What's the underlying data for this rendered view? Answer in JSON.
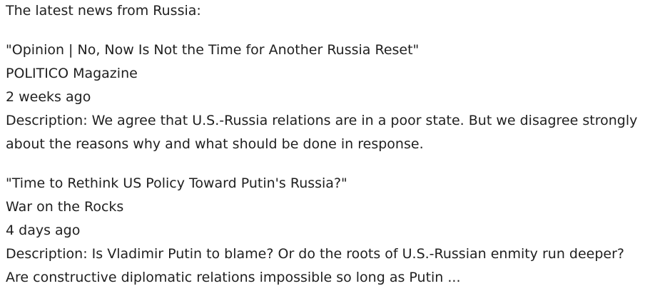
{
  "intro": "The latest news from Russia:",
  "articles": [
    {
      "title": "\"Opinion | No, Now Is Not the Time for Another Russia Reset\"",
      "source": "POLITICO Magazine",
      "time": "2 weeks ago",
      "description": "Description: We agree that U.S.-Russia relations are in a poor state. But we disagree strongly about the reasons why and what should be done in response."
    },
    {
      "title": "\"Time to Rethink US Policy Toward Putin's Russia?\"",
      "source": "War on the Rocks",
      "time": "4 days ago",
      "description": "Description: Is Vladimir Putin to blame? Or do the roots of U.S.-Russian enmity run deeper? Are constructive diplomatic relations impossible so long as Putin ..."
    }
  ]
}
